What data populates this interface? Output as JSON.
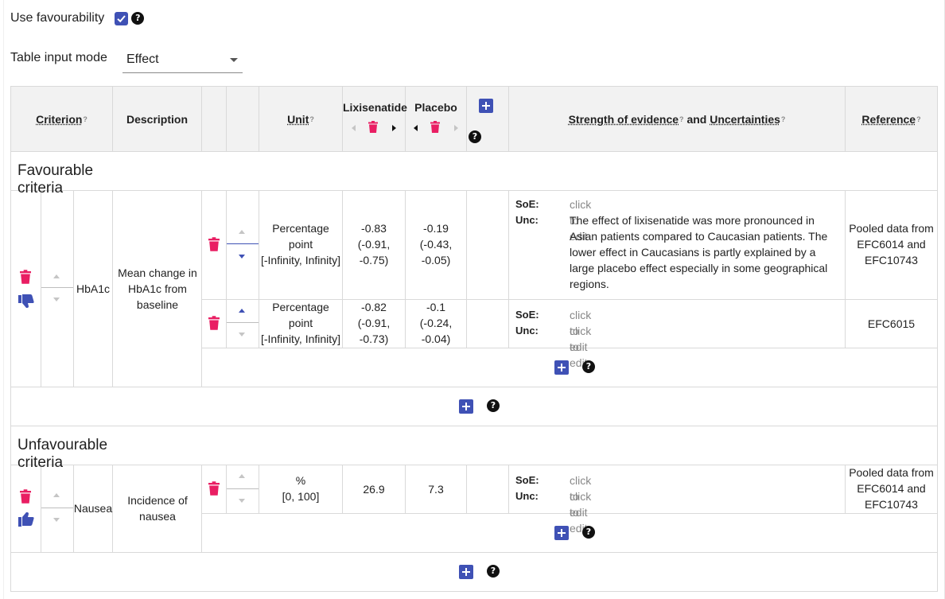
{
  "settings": {
    "favourability_label": "Use favourability",
    "favourability_checked": true,
    "input_mode_label": "Table input mode",
    "input_mode_value": "Effect"
  },
  "table": {
    "headers": {
      "criterion": "Criterion",
      "description": "Description",
      "unit": "Unit",
      "alternative_1": "Lixisenatide",
      "alternative_2": "Placebo",
      "strength_of_evidence": "Strength of evidence",
      "and_text": "and",
      "uncertainties": "Uncertainties",
      "reference": "Reference"
    },
    "favourable": {
      "title": "Favourable criteria",
      "criterion": {
        "title": "HbA1c",
        "description": "Mean change in HbA1c from baseline",
        "favourability": "unfavourable-toggle",
        "data_sources": [
          {
            "unit_line1": "Percentage",
            "unit_line2": "point",
            "unit_line3": "[-Infinity, Infinity]",
            "alt1": [
              "-0.83",
              "(-0.91,",
              "-0.75)"
            ],
            "alt2": [
              "-0.19",
              "(-0.43,",
              "-0.05)"
            ],
            "soe_label": "SoE:",
            "soe_value": "click to edit",
            "unc_label": "Unc:",
            "unc_value": "The effect of lixisenatide was more pronounced in Asian patients compared to Caucasian patients. The lower effect in Caucasians is partly explained by a large placebo effect especially in some geographical regions.",
            "reference": "Pooled data from EFC6014 and EFC10743"
          },
          {
            "unit_line1": "Percentage",
            "unit_line2": "point",
            "unit_line3": "[-Infinity, Infinity]",
            "alt1": [
              "-0.82",
              "(-0.91,",
              "-0.73)"
            ],
            "alt2": [
              "-0.1",
              "(-0.24,",
              "-0.04)"
            ],
            "soe_label": "SoE:",
            "soe_value": "click to edit",
            "unc_label": "Unc:",
            "unc_value": "click to edit",
            "reference": "EFC6015"
          }
        ]
      }
    },
    "unfavourable": {
      "title": "Unfavourable criteria",
      "criterion": {
        "title": "Nausea",
        "description": "Incidence of nausea",
        "favourability": "favourable-toggle",
        "data_sources": [
          {
            "unit_line1": "%",
            "unit_line2": "[0, 100]",
            "alt1": "26.9",
            "alt2": "7.3",
            "soe_label": "SoE:",
            "soe_value": "click to edit",
            "unc_label": "Unc:",
            "unc_value": "click to edit",
            "reference": "Pooled data from EFC6014 and EFC10743"
          }
        ]
      }
    }
  },
  "help_glyph": "?",
  "colors": {
    "primary": "#3f51b5",
    "delete": "#e91e63",
    "header_bg": "#f2f2f2",
    "border": "#d9d9d9",
    "placeholder": "#888888"
  }
}
